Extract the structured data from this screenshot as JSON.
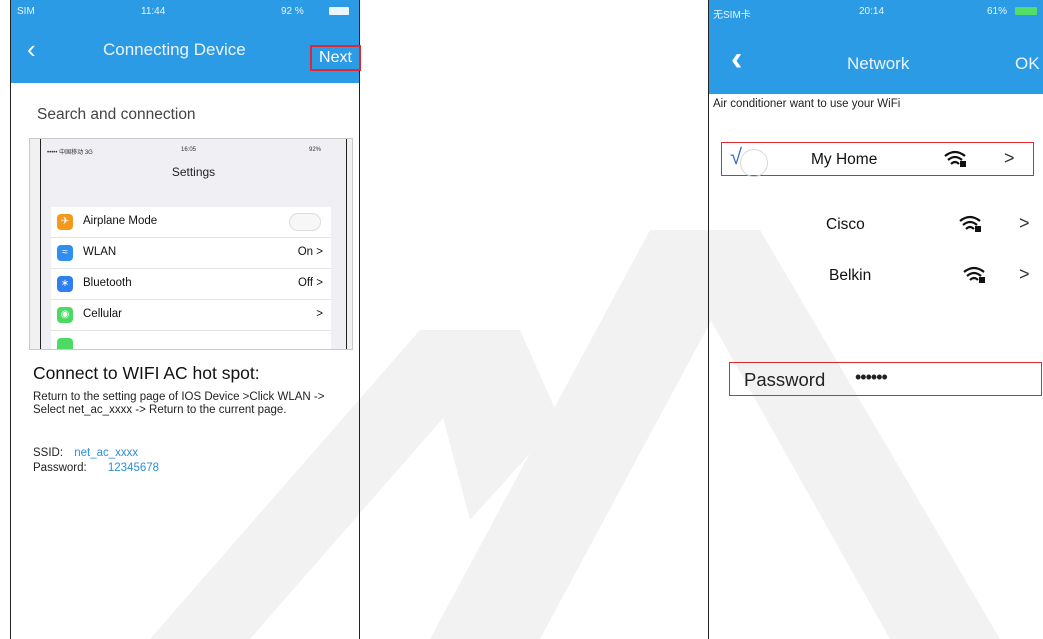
{
  "colors": {
    "accent": "#2b9be6",
    "highlight": "#e0282e",
    "link": "#2b8fd8"
  },
  "left_phone": {
    "status": {
      "carrier": "SIM",
      "time": "11:44",
      "battery": "92 %"
    },
    "nav_title": "Connecting Device",
    "next_label": "Next",
    "search_title": "Search and connection",
    "settings_screenshot": {
      "status_carrier": "••••• 中国移动 3G",
      "status_time": "16:05",
      "status_battery": "92%",
      "heading": "Settings",
      "rows": [
        {
          "icon": "airplane-icon",
          "label": "Airplane Mode",
          "value": ""
        },
        {
          "icon": "wifi-icon",
          "label": "WLAN",
          "value": "On >"
        },
        {
          "icon": "bluetooth-icon",
          "label": "Bluetooth",
          "value": "Off >"
        },
        {
          "icon": "cellular-icon",
          "label": "Cellular",
          "value": ">"
        }
      ]
    },
    "hotspot_title": "Connect to WIFI AC hot spot:",
    "instructions": "Return to the setting page of IOS Device  >Click WLAN -> Select net_ac_xxxx  -> Return to the current page.",
    "ssid_label": "SSID:",
    "ssid_value": "net_ac_xxxx",
    "password_label": "Password:",
    "password_value": "12345678"
  },
  "right_phone": {
    "status": {
      "carrier": "无SIM卡",
      "time": "20:14",
      "battery": "61%"
    },
    "nav_title": "Network",
    "ok_label": "OK",
    "prompt": "Air conditioner want to use your WiFi",
    "networks": [
      {
        "name": "My Home",
        "selected": true
      },
      {
        "name": "Cisco",
        "selected": false
      },
      {
        "name": "Belkin",
        "selected": false
      }
    ],
    "checkmark": "√",
    "chevron": ">",
    "password_label": "Password",
    "password_value": "••••••"
  },
  "watermark": "MIA"
}
